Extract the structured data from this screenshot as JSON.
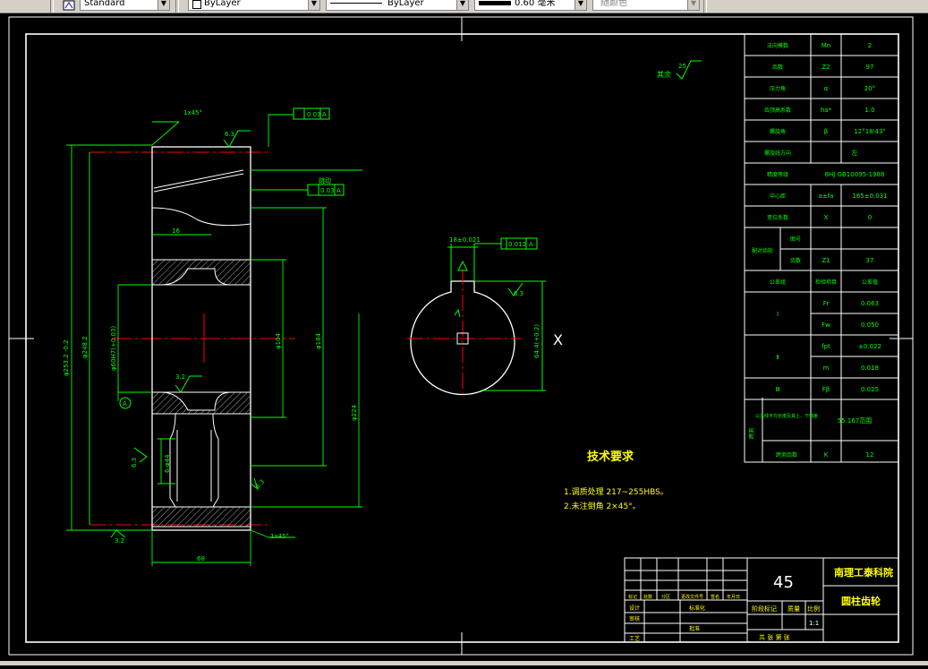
{
  "toolbar": {
    "text_style": "Standard",
    "layer": "ByLayer",
    "linetype": "ByLayer",
    "lineweight": "0.60 毫米",
    "plot_style": "随颜色"
  },
  "title_block": {
    "material": "45",
    "school": "南理工泰科院",
    "part_name": "圆柱齿轮",
    "scale_label": "比例",
    "scale": "1:1",
    "mass_label": "质量",
    "stage_label": "阶段标记",
    "sheets": "共  张  第  张",
    "rev_headers": [
      "标记",
      "处数",
      "分区",
      "更改文件号",
      "签名",
      "年月日"
    ],
    "sign_rows": [
      "设计",
      "审核",
      "工艺"
    ],
    "std_label": "标准化",
    "approve_label": "批准"
  },
  "params": [
    {
      "name": "法向模数",
      "sym": "Mn",
      "val": "2"
    },
    {
      "name": "齿数",
      "sym": "Z2",
      "val": "97"
    },
    {
      "name": "压力角",
      "sym": "α",
      "val": "20°"
    },
    {
      "name": "齿顶高系数",
      "sym": "ha*",
      "val": "1.0"
    },
    {
      "name": "螺旋角",
      "sym": "β",
      "val": "12°18'43\""
    },
    {
      "name": "螺旋线方向",
      "sym": "",
      "val": "左"
    },
    {
      "name": "精度等级",
      "sym": "",
      "val": "8HJ GB10095-1988"
    },
    {
      "name": "中心距",
      "sym": "a±fa",
      "val": "165±0.031"
    },
    {
      "name": "变位系数",
      "sym": "X",
      "val": "0"
    }
  ],
  "mating": {
    "label": "配对齿轮",
    "row1": "图号",
    "row2": "齿数",
    "sym": "Z1",
    "val": "37"
  },
  "inspection": {
    "headers": [
      "公差组",
      "检验项目",
      "公差值"
    ],
    "groups": [
      {
        "group": "Ⅰ",
        "rows": [
          {
            "item": "Fr",
            "val": "0.063"
          },
          {
            "item": "Fw",
            "val": "0.050"
          }
        ]
      },
      {
        "group": "Ⅱ",
        "rows": [
          {
            "item": "fpt",
            "val": "±0.022"
          },
          {
            "item": "m",
            "val": "0.018"
          }
        ]
      },
      {
        "group": "Ⅲ",
        "rows": [
          {
            "item": "Fβ",
            "val": "0.025"
          }
        ]
      }
    ],
    "span_group": "跨测",
    "span_label": "公法线平均长度及其上、下偏差",
    "span_val": "55.167范围",
    "span_k_label": "跨测齿数",
    "span_k_sym": "K",
    "span_k_val": "12"
  },
  "tech": {
    "title": "技术要求",
    "items": [
      "1.调质处理 217~255HBS。",
      "2.未注倒角 2×45°。"
    ]
  },
  "dims": {
    "rest_rough_label": "其余",
    "rest_rough_val": "25",
    "chamfer_top": "1x45°",
    "chamfer_bottom": "1x45°",
    "runout_label": "A",
    "runout_val1": "0.03",
    "runout_val2": "0.03",
    "runout_note": "跳动",
    "ra_63a": "6.3",
    "ra_32a": "3.2",
    "ra_32b": "3.2",
    "ra_63b": "6.3",
    "ra_63c": "6.3",
    "ra_63d": "6.3",
    "d_outer": "φ253.2 -0.2",
    "d_pitch": "φ248.2",
    "d_bore": "φ60H7(+0.03)",
    "d_hub": "φ104",
    "d_web": "φ184",
    "d_rim": "φ224",
    "w_16": "16",
    "w_68": "68",
    "holes": "6-φ44",
    "datum": "A",
    "key_width": "18±0.021",
    "key_depth": "64.4(+0.2)",
    "sym_tol": "0.012",
    "sym_datum": "A",
    "x_label": "X"
  }
}
